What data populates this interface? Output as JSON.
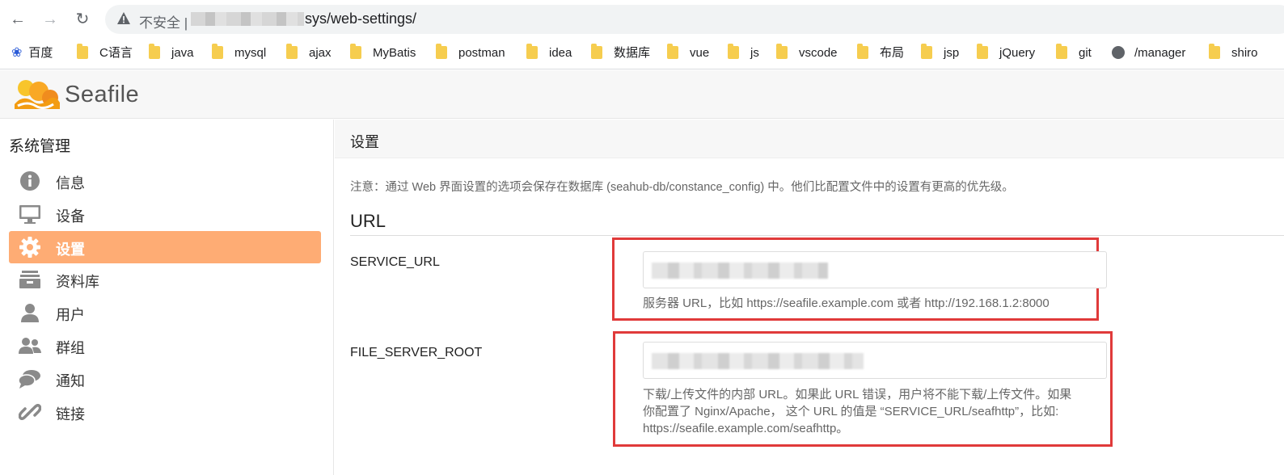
{
  "browser": {
    "security_label": "不安全 |",
    "url_path": "sys/web-settings/",
    "bookmarks": [
      {
        "label": "百度",
        "icon": "baidu-paw-icon"
      },
      {
        "label": "C语言",
        "icon": "folder-icon"
      },
      {
        "label": "java",
        "icon": "folder-icon"
      },
      {
        "label": "mysql",
        "icon": "folder-icon"
      },
      {
        "label": "ajax",
        "icon": "folder-icon"
      },
      {
        "label": "MyBatis",
        "icon": "folder-icon"
      },
      {
        "label": "postman",
        "icon": "folder-icon"
      },
      {
        "label": "idea",
        "icon": "folder-icon"
      },
      {
        "label": "数据库",
        "icon": "folder-icon"
      },
      {
        "label": "vue",
        "icon": "folder-icon"
      },
      {
        "label": "js",
        "icon": "folder-icon"
      },
      {
        "label": "vscode",
        "icon": "folder-icon"
      },
      {
        "label": "布局",
        "icon": "folder-icon"
      },
      {
        "label": "jsp",
        "icon": "folder-icon"
      },
      {
        "label": "jQuery",
        "icon": "folder-icon"
      },
      {
        "label": "git",
        "icon": "folder-icon"
      },
      {
        "label": "/manager",
        "icon": "globe-icon"
      },
      {
        "label": "shiro",
        "icon": "folder-icon"
      }
    ]
  },
  "app": {
    "logo_text": "Seafile"
  },
  "sidebar": {
    "title": "系统管理",
    "items": [
      {
        "label": "信息",
        "icon": "info-icon"
      },
      {
        "label": "设备",
        "icon": "monitor-icon"
      },
      {
        "label": "设置",
        "icon": "gear-icon",
        "active": true
      },
      {
        "label": "资料库",
        "icon": "archive-icon"
      },
      {
        "label": "用户",
        "icon": "user-icon"
      },
      {
        "label": "群组",
        "icon": "group-icon"
      },
      {
        "label": "通知",
        "icon": "chat-icon"
      },
      {
        "label": "链接",
        "icon": "link-icon"
      }
    ]
  },
  "main": {
    "title": "设置",
    "note": "注意：通过 Web 界面设置的选项会保存在数据库 (seahub-db/constance_config) 中。他们比配置文件中的设置有更高的优先级。",
    "section_title": "URL",
    "fields": [
      {
        "label": "SERVICE_URL",
        "help": "服务器 URL，比如 https://seafile.example.com 或者 http://192.168.1.2:8000"
      },
      {
        "label": "FILE_SERVER_ROOT",
        "help_lines": [
          "下载/上传文件的内部 URL。如果此 URL 错误，用户将不能下载/上传文件。如果",
          "你配置了 Nginx/Apache， 这个 URL 的值是 “SERVICE_URL/seafhttp”，比如:",
          "https://seafile.example.com/seafhttp。"
        ]
      }
    ]
  },
  "colors": {
    "active_item": "#feac74",
    "highlight_box": "#e03a3a"
  }
}
